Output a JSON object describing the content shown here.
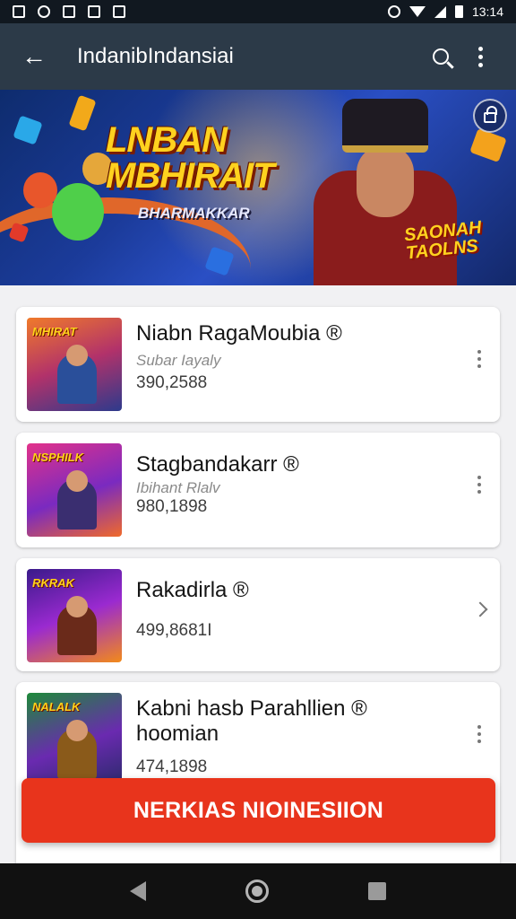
{
  "status_bar": {
    "time": "13:14"
  },
  "app_bar": {
    "back_icon": "←",
    "title": "IndanibIndansiai"
  },
  "banner": {
    "title_line1": "LNBAN",
    "title_line2": "MBHIRAIT",
    "subtitle": "BHARMAKKAR",
    "tag_line1": "SAONAH",
    "tag_line2": "TAOLNS"
  },
  "items": [
    {
      "thumb_label": "MHIRAT",
      "title": "Niabn RagaMoubia ®",
      "subtitle": "Subar Iayaly",
      "count": "390,2588",
      "action": "more"
    },
    {
      "thumb_label": "NSPHILK",
      "title": "Stagbandakarr ®",
      "subtitle": "Ibihant Rlalv",
      "count": "980,1898",
      "action": "more"
    },
    {
      "thumb_label": "RKRAK",
      "title": "Rakadirla ®",
      "subtitle": "",
      "count": "499,8681I",
      "action": "chevron"
    },
    {
      "thumb_label": "NALALK",
      "title": "Kabni hasb Parahllien ®",
      "title_line2": "hoomian",
      "count": "474,1898",
      "action": "more"
    }
  ],
  "cta": {
    "label": "NERKIAS NIOINESIION"
  }
}
